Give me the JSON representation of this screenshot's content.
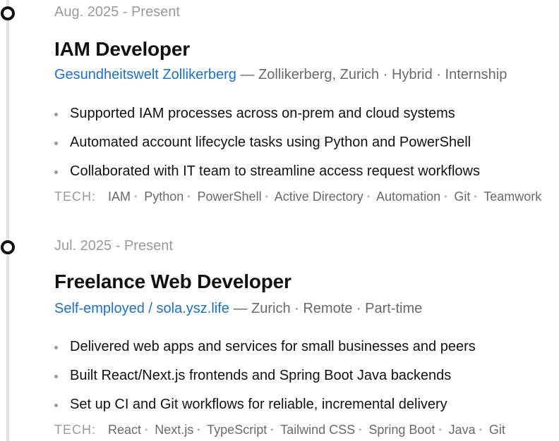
{
  "entries": [
    {
      "date": "Aug. 2025 - Present",
      "title": "IAM Developer",
      "company": "Gesundheitswelt Zollikerberg",
      "details": " — Zollikerberg, Zurich · Hybrid · Internship",
      "bullets": [
        "Supported IAM processes across on-prem and cloud systems",
        "Automated account lifecycle tasks using Python and PowerShell",
        "Collaborated with IT team to streamline access request workflows"
      ],
      "tech_label": "TECH:",
      "tech": [
        "IAM",
        "Python",
        "PowerShell",
        "Active Directory",
        "Automation",
        "Git",
        "Teamwork"
      ]
    },
    {
      "date": "Jul. 2025 - Present",
      "title": "Freelance Web Developer",
      "company": "Self-employed / sola.ysz.life",
      "details": " — Zurich · Remote · Part-time",
      "bullets": [
        "Delivered web apps and services for small businesses and peers",
        "Built React/Next.js frontends and Spring Boot Java backends",
        "Set up CI and Git workflows for reliable, incremental delivery"
      ],
      "tech_label": "TECH:",
      "tech": [
        "React",
        "Next.js",
        "TypeScript",
        "Tailwind CSS",
        "Spring Boot",
        "Java",
        "Git"
      ]
    }
  ],
  "colors": {
    "accent_link": "#1f6fc5",
    "timeline_line": "#e3e3e3",
    "muted_text": "#9a9a9a"
  }
}
